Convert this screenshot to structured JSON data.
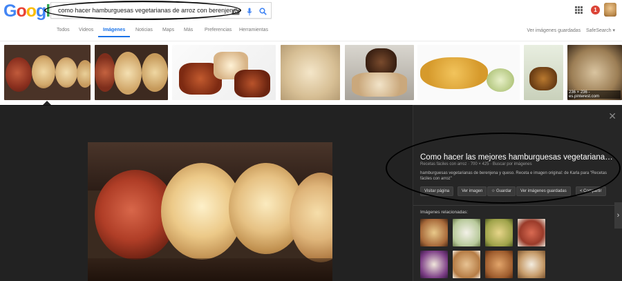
{
  "logo": {
    "g1": "G",
    "o1": "o",
    "o2": "o",
    "g2": "g",
    "l": "l",
    "e": "e"
  },
  "search": {
    "query": "como hacer hamburguesas vegetarianas de arroz con berenjena"
  },
  "header": {
    "notifications_count": "1",
    "camera_icon": "camera-icon",
    "mic_icon": "mic-icon",
    "search_icon": "search-icon"
  },
  "nav": {
    "tabs": [
      {
        "label": "Todos"
      },
      {
        "label": "Videos"
      },
      {
        "label": "Imágenes"
      },
      {
        "label": "Noticias"
      },
      {
        "label": "Maps"
      },
      {
        "label": "Más"
      },
      {
        "label": "Preferencias"
      },
      {
        "label": "Herramientas"
      }
    ],
    "saved_images": "Ver imágenes guardadas",
    "safesearch": "SafeSearch ▾"
  },
  "strip": {
    "last_caption": "236 × 236 - es.pinterest.com"
  },
  "viewer": {
    "title": "Como hacer las mejores hamburguesas vegetarianas de arroz",
    "meta": "Recetas fáciles con arroz · 700 × 425 · Buscar por imágenes",
    "description": "hamburguesas vegetarianas de berenjena y queso. Receta e imagen original: de Karla para \"Recetas fáciles con arroz\"",
    "buttons": [
      {
        "label": "Visitar página"
      },
      {
        "label": "Ver imagen"
      },
      {
        "label": "☆ Guardar"
      },
      {
        "label": "Ver imágenes guardadas"
      },
      {
        "label": "< Compartir"
      }
    ],
    "related_label": "Imágenes relacionadas:",
    "close_icon": "✕",
    "next_icon": "›"
  },
  "colors": {
    "accent": "#1a73e8",
    "viewer_bg": "#222222",
    "sidebar_bg": "#262626"
  }
}
